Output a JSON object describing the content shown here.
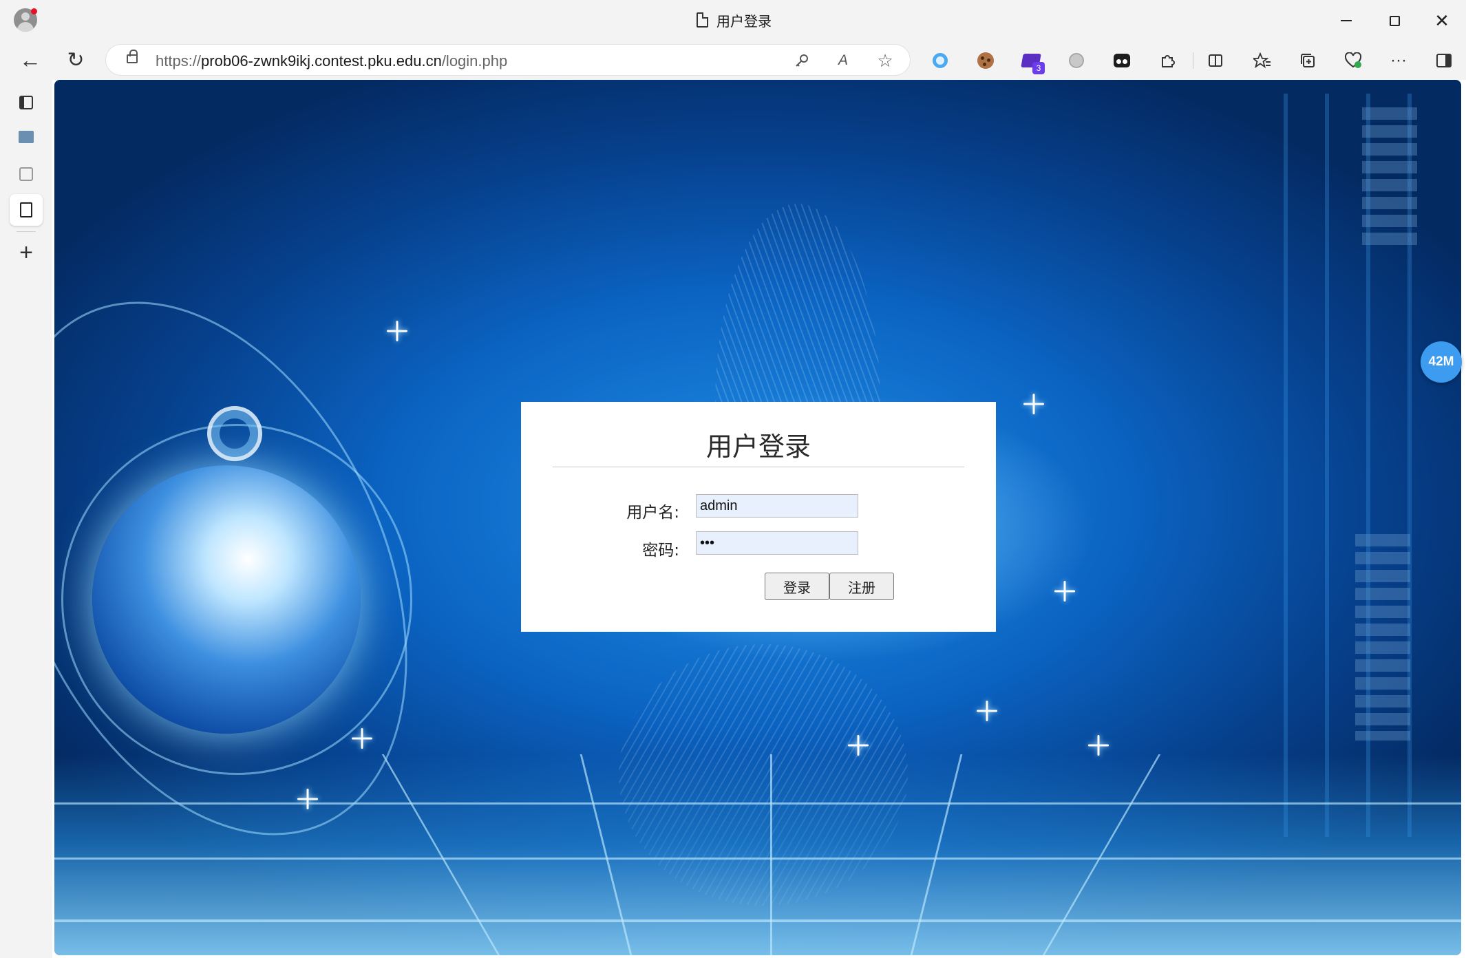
{
  "window": {
    "title": "用户登录",
    "minimize_icon": "minimize-icon",
    "maximize_icon": "maximize-icon",
    "close_glyph": "✕"
  },
  "toolbar": {
    "back_glyph": "←",
    "reload_glyph": "↻",
    "url_scheme": "https://",
    "url_host": "prob06-zwnk9ikj.contest.pku.edu.cn",
    "url_path": "/login.php",
    "read_aloud_glyph": "A",
    "favorite_glyph": "☆",
    "extensions": [
      "circle-extension-icon",
      "cookie-extension-icon",
      "graduation-extension-icon",
      "gray-extension-icon",
      "dark-extension-icon"
    ],
    "extension_badge": "3",
    "more_glyph": "···"
  },
  "sidebar": {
    "plus_glyph": "+"
  },
  "login": {
    "title": "用户登录",
    "username_label": "用户名:",
    "username_value": "admin",
    "password_label": "密码:",
    "password_value": "•••",
    "login_button": "登录",
    "register_button": "注册"
  },
  "overlay": {
    "memory_badge": "42M"
  },
  "colors": {
    "accent": "#3d9cf0",
    "background_blue": "#0b63c2",
    "input_autofill": "#e8f0fe"
  }
}
